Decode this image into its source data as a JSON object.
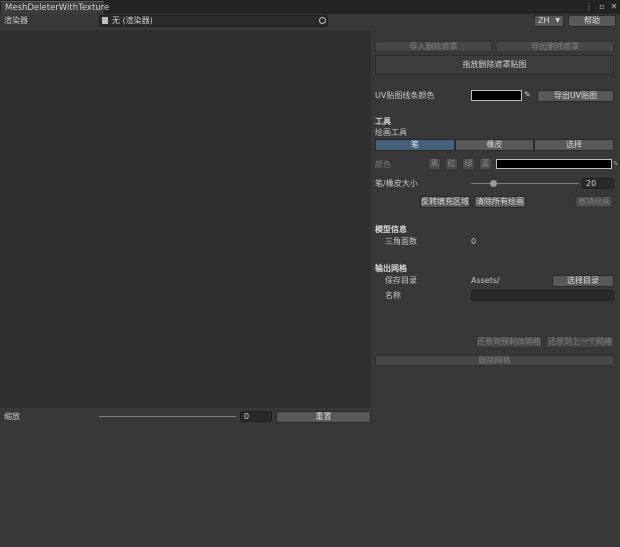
{
  "window": {
    "tab_title": "MeshDeleterWithTexture",
    "menu_icon": "kebab-menu-icon",
    "maximize_icon": "maximize-icon",
    "close_icon": "close-icon"
  },
  "header": {
    "renderer_label": "渲染器",
    "renderer_value": "无 (渲染器)",
    "renderer_picker_icon": "object-picker-icon",
    "language_value": "ZH",
    "help_label": "帮助"
  },
  "canvas": {
    "zoom_label": "缩放",
    "zoom_value": "0",
    "zoom_level": 0,
    "reset_label": "重置"
  },
  "mask": {
    "import_label": "导入删除遮罩",
    "export_label": "导出删除遮罩",
    "drop_area_label": "拖放删除遮罩贴图"
  },
  "uv": {
    "line_color_label": "UV贴图线条颜色",
    "line_color": "#000000",
    "export_label": "导出UV贴图"
  },
  "tools": {
    "section_title": "工具",
    "draw_tools_label": "绘画工具",
    "modes": [
      {
        "label": "笔",
        "selected": true
      },
      {
        "label": "橡皮",
        "selected": false
      },
      {
        "label": "选择",
        "selected": false
      }
    ],
    "color_label": "颜色",
    "color_presets": [
      "黑",
      "红",
      "绿",
      "蓝"
    ],
    "pen_color": "#000000",
    "size_label": "笔/橡皮大小",
    "size_value": "20",
    "size_fraction": 0.2,
    "invert_fill_label": "反转填充区域",
    "clear_all_label": "清除所有绘画",
    "undo_label": "撤销绘画"
  },
  "model_info": {
    "section_title": "模型信息",
    "triangle_label": "三角面数",
    "triangle_value": "0"
  },
  "output": {
    "section_title": "输出网格",
    "save_dir_label": "保存目录",
    "save_dir_value": "Assets/",
    "choose_dir_label": "选择目录",
    "name_label": "名称",
    "name_value": "",
    "revert_prefab_label": "还原到预制体网格",
    "revert_previous_label": "还原到上一个网格",
    "delete_mesh_label": "删除网格"
  },
  "accent": "#46607c"
}
